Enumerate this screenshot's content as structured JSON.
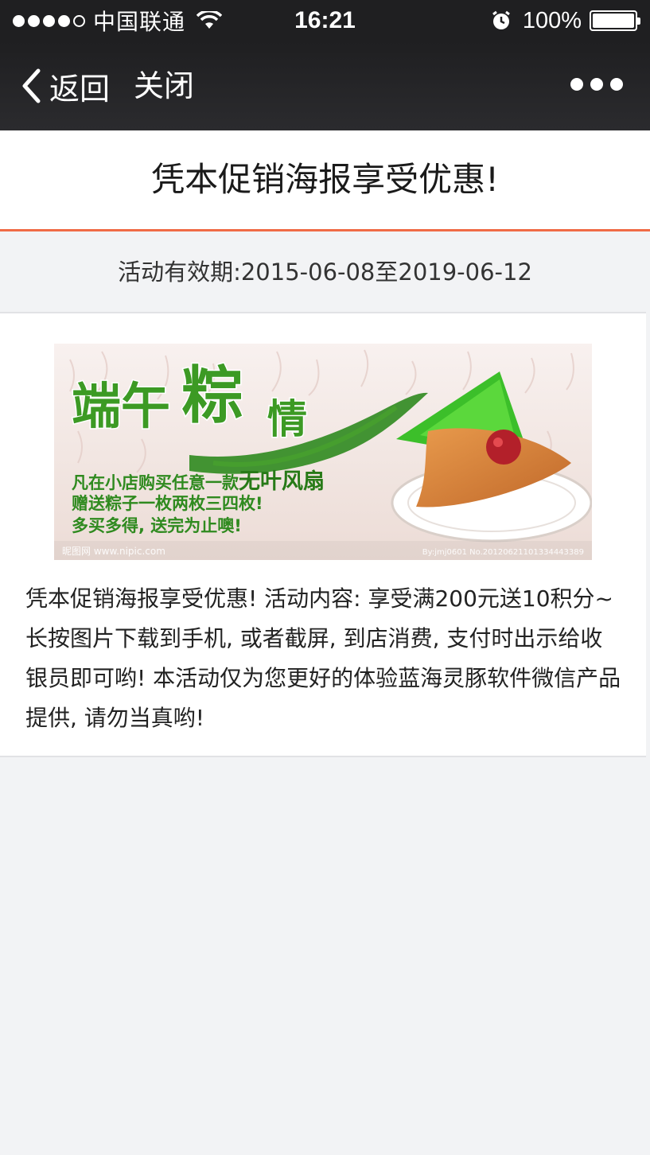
{
  "status_bar": {
    "carrier": "中国联通",
    "time": "16:21",
    "battery_percent": "100%",
    "signal_bars": 4,
    "signal_total": 5
  },
  "nav": {
    "back_label": "返回",
    "close_label": "关闭",
    "more_icon": "more-dots-icon"
  },
  "page": {
    "title": "凭本促销海报享受优惠!",
    "validity": "活动有效期:2015-06-08至2019-06-12",
    "description": "凭本促销海报享受优惠! 活动内容: 享受满200元送10积分~ 长按图片下载到手机, 或者截屏, 到店消费, 支付时出示给收银员即可哟! 本活动仅为您更好的体验蓝海灵豚软件微信产品提供, 请勿当真哟!"
  },
  "poster": {
    "headline_1": "端午",
    "headline_2": "粽",
    "headline_3": "情",
    "line_1_prefix": "凡在小店购买任意一款",
    "line_1_highlight": "无叶风扇",
    "line_2": "赠送粽子一枚两枚三四枚!",
    "line_3": "多买多得, 送完为止噢!",
    "watermark_left": "昵图网 www.nipic.com",
    "watermark_right": "By:jmj0601 No.20120621101334443389"
  },
  "colors": {
    "accent": "#f06b45",
    "nav_bg": "#1f1f21",
    "page_bg": "#f2f3f5"
  }
}
